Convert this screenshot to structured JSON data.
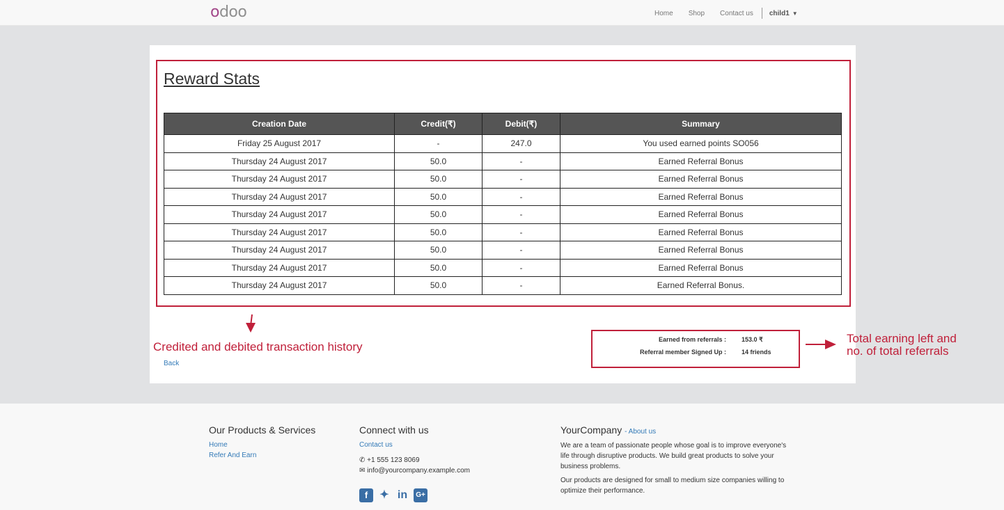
{
  "nav": {
    "logo_first": "o",
    "logo_rest": "doo",
    "links": [
      "Home",
      "Shop",
      "Contact us"
    ],
    "user": "child1"
  },
  "page": {
    "title": "Reward Stats",
    "table": {
      "headers": [
        "Creation Date",
        "Credit(₹)",
        "Debit(₹)",
        "Summary"
      ],
      "rows": [
        [
          "Friday 25 August 2017",
          "-",
          "247.0",
          "You used earned points SO056"
        ],
        [
          "Thursday 24 August 2017",
          "50.0",
          "-",
          "Earned Referral Bonus"
        ],
        [
          "Thursday 24 August 2017",
          "50.0",
          "-",
          "Earned Referral Bonus"
        ],
        [
          "Thursday 24 August 2017",
          "50.0",
          "-",
          "Earned Referral Bonus"
        ],
        [
          "Thursday 24 August 2017",
          "50.0",
          "-",
          "Earned Referral Bonus"
        ],
        [
          "Thursday 24 August 2017",
          "50.0",
          "-",
          "Earned Referral Bonus"
        ],
        [
          "Thursday 24 August 2017",
          "50.0",
          "-",
          "Earned Referral Bonus"
        ],
        [
          "Thursday 24 August 2017",
          "50.0",
          "-",
          "Earned Referral Bonus"
        ],
        [
          "Thursday 24 August 2017",
          "50.0",
          "-",
          "Earned Referral Bonus."
        ]
      ]
    },
    "back_label": "Back",
    "summary": {
      "earned_label": "Earned from referrals :",
      "earned_value": "153.0 ₹",
      "signed_label": "Referral member Signed Up :",
      "signed_value": "14 friends"
    },
    "annotations": {
      "left": "Credited and debited transaction history",
      "right_line1": "Total earning left and",
      "right_line2": "no. of total referrals",
      "color": "#c0203a"
    }
  },
  "footer": {
    "col1": {
      "heading": "Our Products & Services",
      "links": [
        "Home",
        "Refer And Earn"
      ]
    },
    "col2": {
      "heading": "Connect with us",
      "link": "Contact us",
      "phone": "+1 555 123 8069",
      "email": "info@yourcompany.example.com",
      "social_icons": [
        "facebook-icon",
        "twitter-icon",
        "linkedin-icon",
        "google-plus-icon"
      ]
    },
    "col3": {
      "heading": "YourCompany",
      "about": "- About us",
      "para1": "We are a team of passionate people whose goal is to improve everyone's life through disruptive products. We build great products to solve your business problems.",
      "para2": "Our products are designed for small to medium size companies willing to optimize their performance."
    }
  }
}
